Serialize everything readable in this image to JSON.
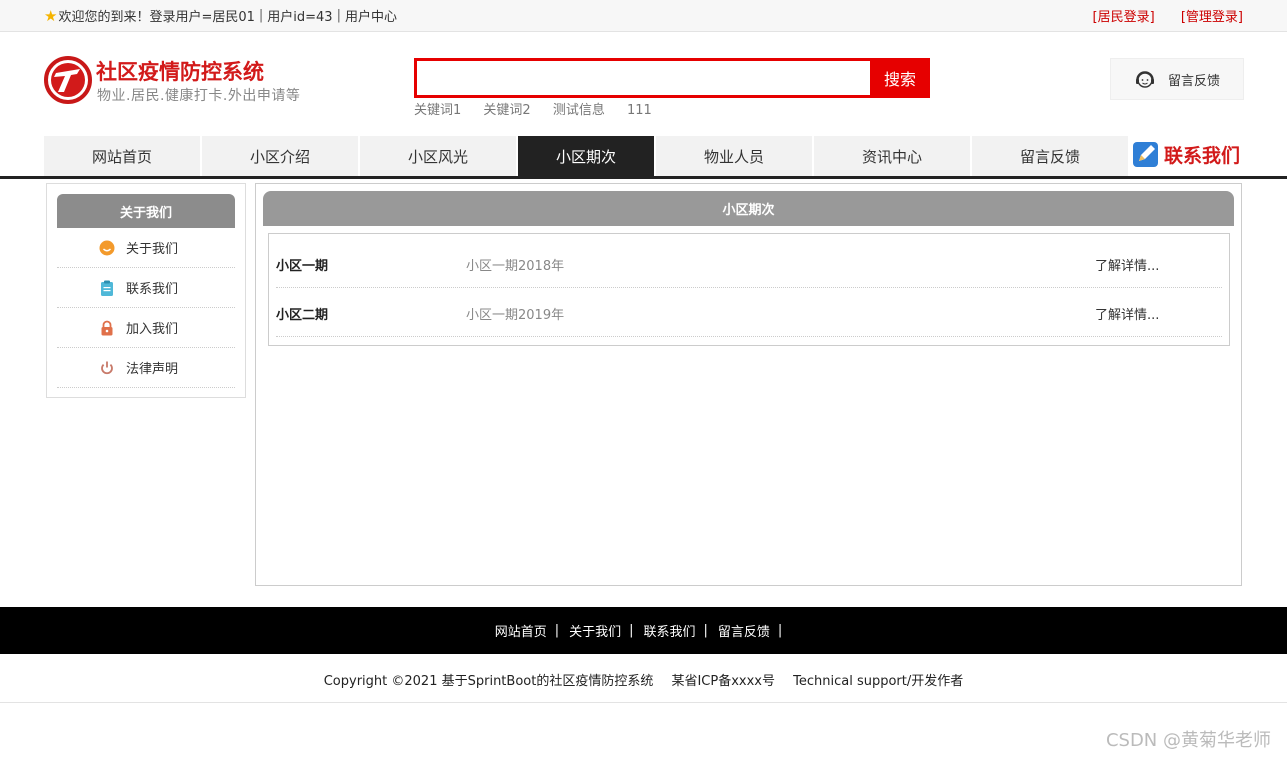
{
  "topbar": {
    "welcome": "欢迎您的到来！登录用户=居民01",
    "user_id": "用户id=43",
    "user_center": "用户中心",
    "resident_login": "[居民登录]",
    "admin_login": "[管理登录]"
  },
  "header": {
    "title": "社区疫情防控系统",
    "subtitle": "物业.居民.健康打卡.外出申请等",
    "search_button": "搜索",
    "search_value": "",
    "keywords": [
      "关键词1",
      "关键词2",
      "测试信息",
      "111"
    ],
    "feedback": "留言反馈",
    "brand_color": "#d21a1a",
    "accent_color": "#e60000"
  },
  "nav": {
    "items": [
      "网站首页",
      "小区介绍",
      "小区风光",
      "小区期次",
      "物业人员",
      "资讯中心",
      "留言反馈"
    ],
    "active": "小区期次",
    "contact": "联系我们"
  },
  "sidebar": {
    "title": "关于我们",
    "items": [
      {
        "label": "关于我们",
        "icon": "smile-icon"
      },
      {
        "label": "联系我们",
        "icon": "clipboard-icon"
      },
      {
        "label": "加入我们",
        "icon": "lock-icon"
      },
      {
        "label": "法律声明",
        "icon": "power-icon"
      }
    ]
  },
  "main": {
    "title": "小区期次",
    "rows": [
      {
        "name": "小区一期",
        "desc": "小区一期2018年",
        "more": "了解详情..."
      },
      {
        "name": "小区二期",
        "desc": "小区一期2019年",
        "more": "了解详情..."
      }
    ]
  },
  "footer": {
    "links": [
      "网站首页",
      "关于我们",
      "联系我们",
      "留言反馈"
    ],
    "separator": "|",
    "copyright": "Copyright ©2021 基于SprintBoot的社区疫情防控系统",
    "icp": "某省ICP备xxxx号",
    "support": "Technical support/开发作者"
  },
  "watermark": "CSDN @黄菊华老师"
}
